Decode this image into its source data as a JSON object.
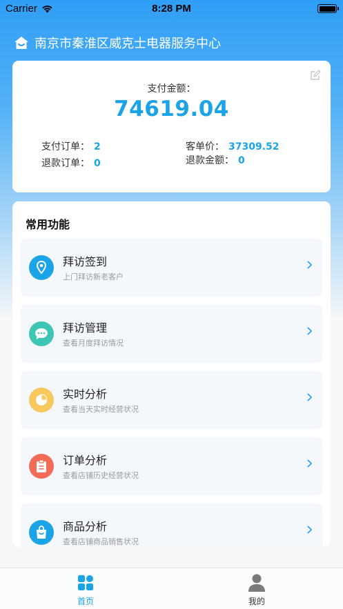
{
  "status_bar": {
    "carrier": "Carrier",
    "time": "8:28 PM"
  },
  "header": {
    "store_name": "南京市秦淮区威克士电器服务中心"
  },
  "summary": {
    "amount_label": "支付金额：",
    "amount_value": "74619.04",
    "paid_orders_label": "支付订单：",
    "paid_orders_value": "2",
    "refund_orders_label": "退款订单：",
    "refund_orders_value": "0",
    "avg_price_label": "客单价：",
    "avg_price_value": "37309.52",
    "refund_amount_label": "退款金额：",
    "refund_amount_value": "0"
  },
  "functions": {
    "title": "常用功能",
    "items": [
      {
        "title": "拜访签到",
        "subtitle": "上门拜访新老客户",
        "icon": "location-pin-icon",
        "color": "#1aa3e6"
      },
      {
        "title": "拜访管理",
        "subtitle": "查看月度拜访情况",
        "icon": "chat-bubble-icon",
        "color": "#3ec6b4"
      },
      {
        "title": "实时分析",
        "subtitle": "查看当天实时经营状况",
        "icon": "pie-chart-icon",
        "color": "#f7c85c"
      },
      {
        "title": "订单分析",
        "subtitle": "查看店铺历史经营状况",
        "icon": "clipboard-icon",
        "color": "#f26b57"
      },
      {
        "title": "商品分析",
        "subtitle": "查看店铺商品销售状况",
        "icon": "shopping-bag-icon",
        "color": "#1aa3e6"
      }
    ]
  },
  "tab_bar": {
    "home_label": "首页",
    "mine_label": "我的",
    "active_color": "#1aa3e6"
  }
}
